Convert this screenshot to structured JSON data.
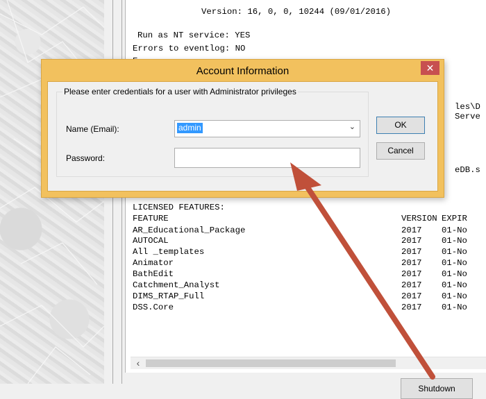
{
  "log": {
    "version_line": "Version: 16, 0, 0, 10244 (09/01/2016)",
    "nt_service_line": "Run as NT service: YES",
    "eventlog_line": "Errors to eventlog: NO",
    "partial_line": "E",
    "right_fragments": [
      "les\\D",
      "Serve",
      "eDB.s"
    ],
    "licensed_header": "LICENSED FEATURES:",
    "table_headers": {
      "feature": "FEATURE",
      "version": "VERSION",
      "expiry": "EXPIR"
    },
    "features": [
      {
        "name": "AR_Educational_Package",
        "version": "2017",
        "expiry": "01-No"
      },
      {
        "name": "AUTOCAL",
        "version": "2017",
        "expiry": "01-No"
      },
      {
        "name": "All _templates",
        "version": "2017",
        "expiry": "01-No"
      },
      {
        "name": "Animator",
        "version": "2017",
        "expiry": "01-No"
      },
      {
        "name": "BathEdit",
        "version": "2017",
        "expiry": "01-No"
      },
      {
        "name": "Catchment_Analyst",
        "version": "2017",
        "expiry": "01-No"
      },
      {
        "name": "DIMS_RTAP_Full",
        "version": "2017",
        "expiry": "01-No"
      },
      {
        "name": "DSS.Core",
        "version": "2017",
        "expiry": "01-No"
      }
    ]
  },
  "scrollbar": {
    "left_arrow": "‹"
  },
  "shutdown_label": "Shutdown",
  "dialog": {
    "title": "Account Information",
    "close_glyph": "✕",
    "group_label": "Please enter credentials for a user with Administrator privileges",
    "name_label": "Name (Email):",
    "name_value": "admin",
    "password_label": "Password:",
    "password_value": "",
    "ok_label": "OK",
    "cancel_label": "Cancel"
  },
  "colors": {
    "title_bar": "#f2c15e",
    "close": "#c75050",
    "arrow": "#c0503a",
    "selection": "#3399ff"
  }
}
